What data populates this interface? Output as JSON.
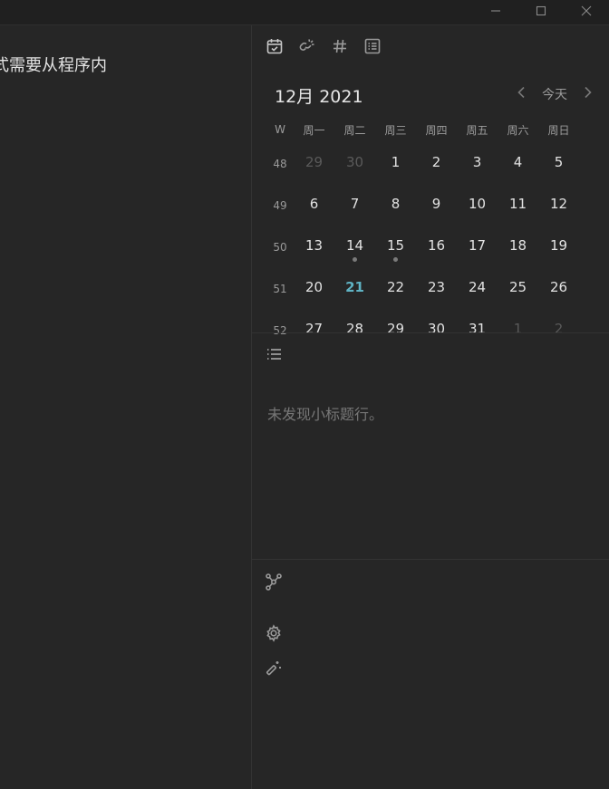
{
  "window": {
    "controls": [
      "minimize-icon",
      "maximize-icon",
      "close-icon"
    ]
  },
  "editor": {
    "title_fragment": "式需要从程序内"
  },
  "sidebar_tabs": [
    "calendar-icon",
    "backlinks-icon",
    "tag-icon",
    "list-icon"
  ],
  "calendar": {
    "month_label": "12月 2021",
    "today_label": "今天",
    "week_header": "W",
    "weekdays": [
      "周一",
      "周二",
      "周三",
      "周四",
      "周五",
      "周六",
      "周日"
    ],
    "weeks": [
      {
        "num": "48",
        "days": [
          "29",
          "30",
          "1",
          "2",
          "3",
          "4",
          "5"
        ]
      },
      {
        "num": "49",
        "days": [
          "6",
          "7",
          "8",
          "9",
          "10",
          "11",
          "12"
        ]
      },
      {
        "num": "50",
        "days": [
          "13",
          "14",
          "15",
          "16",
          "17",
          "18",
          "19"
        ]
      },
      {
        "num": "51",
        "days": [
          "20",
          "21",
          "22",
          "23",
          "24",
          "25",
          "26"
        ]
      },
      {
        "num": "52",
        "days": [
          "27",
          "28",
          "29",
          "30",
          "31",
          "1",
          "2"
        ]
      }
    ],
    "today": "21",
    "days_with_notes": [
      "14",
      "15"
    ],
    "today_color": "#5fb3c4"
  },
  "outline": {
    "icon": "list-bullets-icon",
    "empty_message": "未发现小标题行。"
  },
  "bottom_icons": [
    "graph-icon",
    "settings-icon",
    "magic-wand-icon"
  ]
}
